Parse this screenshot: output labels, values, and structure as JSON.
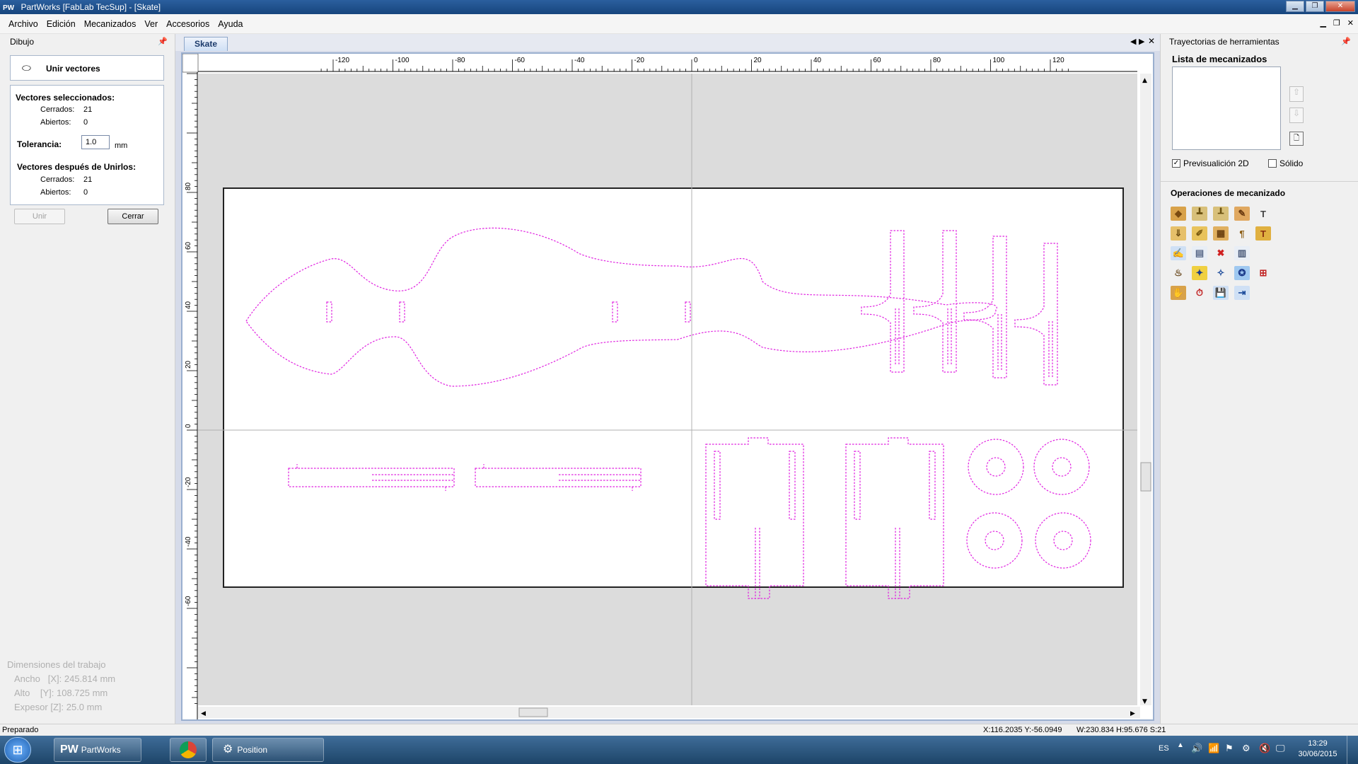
{
  "window": {
    "title": "PartWorks [FabLab TecSup] - [Skate]",
    "app_icon": "PW"
  },
  "menu": [
    "Archivo",
    "Edición",
    "Mecanizados",
    "Ver",
    "Accesorios",
    "Ayuda"
  ],
  "left_panel": {
    "header": "Dibujo",
    "tool_title": "Unir vectores",
    "selected_title": "Vectores seleccionados:",
    "closed_label": "Cerrados:",
    "closed_value": "21",
    "open_label": "Abiertos:",
    "open_value": "0",
    "tolerance_label": "Tolerancia:",
    "tolerance_value": "1.0",
    "tolerance_unit": "mm",
    "after_title": "Vectores después de Unirlos:",
    "after_closed_value": "21",
    "after_open_value": "0",
    "join_button": "Unir",
    "close_button": "Cerrar",
    "dims_title": "Dimensiones del trabajo",
    "width_label": "Ancho",
    "width_axis": "[X]:",
    "width_value": "245.814 mm",
    "height_label": "Alto",
    "height_axis": "[Y]:",
    "height_value": "108.725 mm",
    "thickness_label": "Expesor",
    "thickness_axis": "[Z]:",
    "thickness_value": "25.0 mm"
  },
  "document": {
    "tab": "Skate",
    "ruler_top": [
      "-120",
      "-100",
      "-80",
      "-60",
      "-40",
      "-20",
      "0",
      "20",
      "40",
      "60",
      "80",
      "100",
      "120"
    ],
    "ruler_left": [
      "80",
      "60",
      "40",
      "20",
      "0",
      "-20",
      "-40",
      "-60"
    ],
    "vector_color": "#e020e0"
  },
  "right_panel": {
    "header": "Trayectorias de herramientas",
    "list_title": "Lista de mecanizados",
    "preview_label": "Previsualición 2D",
    "preview_checked": true,
    "solid_label": "Sólido",
    "solid_checked": false,
    "operations_title": "Operaciones de mecanizado"
  },
  "status": {
    "text": "Preparado",
    "coords": "X:116.2035 Y:-56.0949",
    "size": "W:230.834  H:95.676  S:21"
  },
  "taskbar": {
    "item1": "PartWorks [FabLa...",
    "item3": "Position",
    "lang": "ES",
    "time": "13:29",
    "date": "30/06/2015"
  }
}
